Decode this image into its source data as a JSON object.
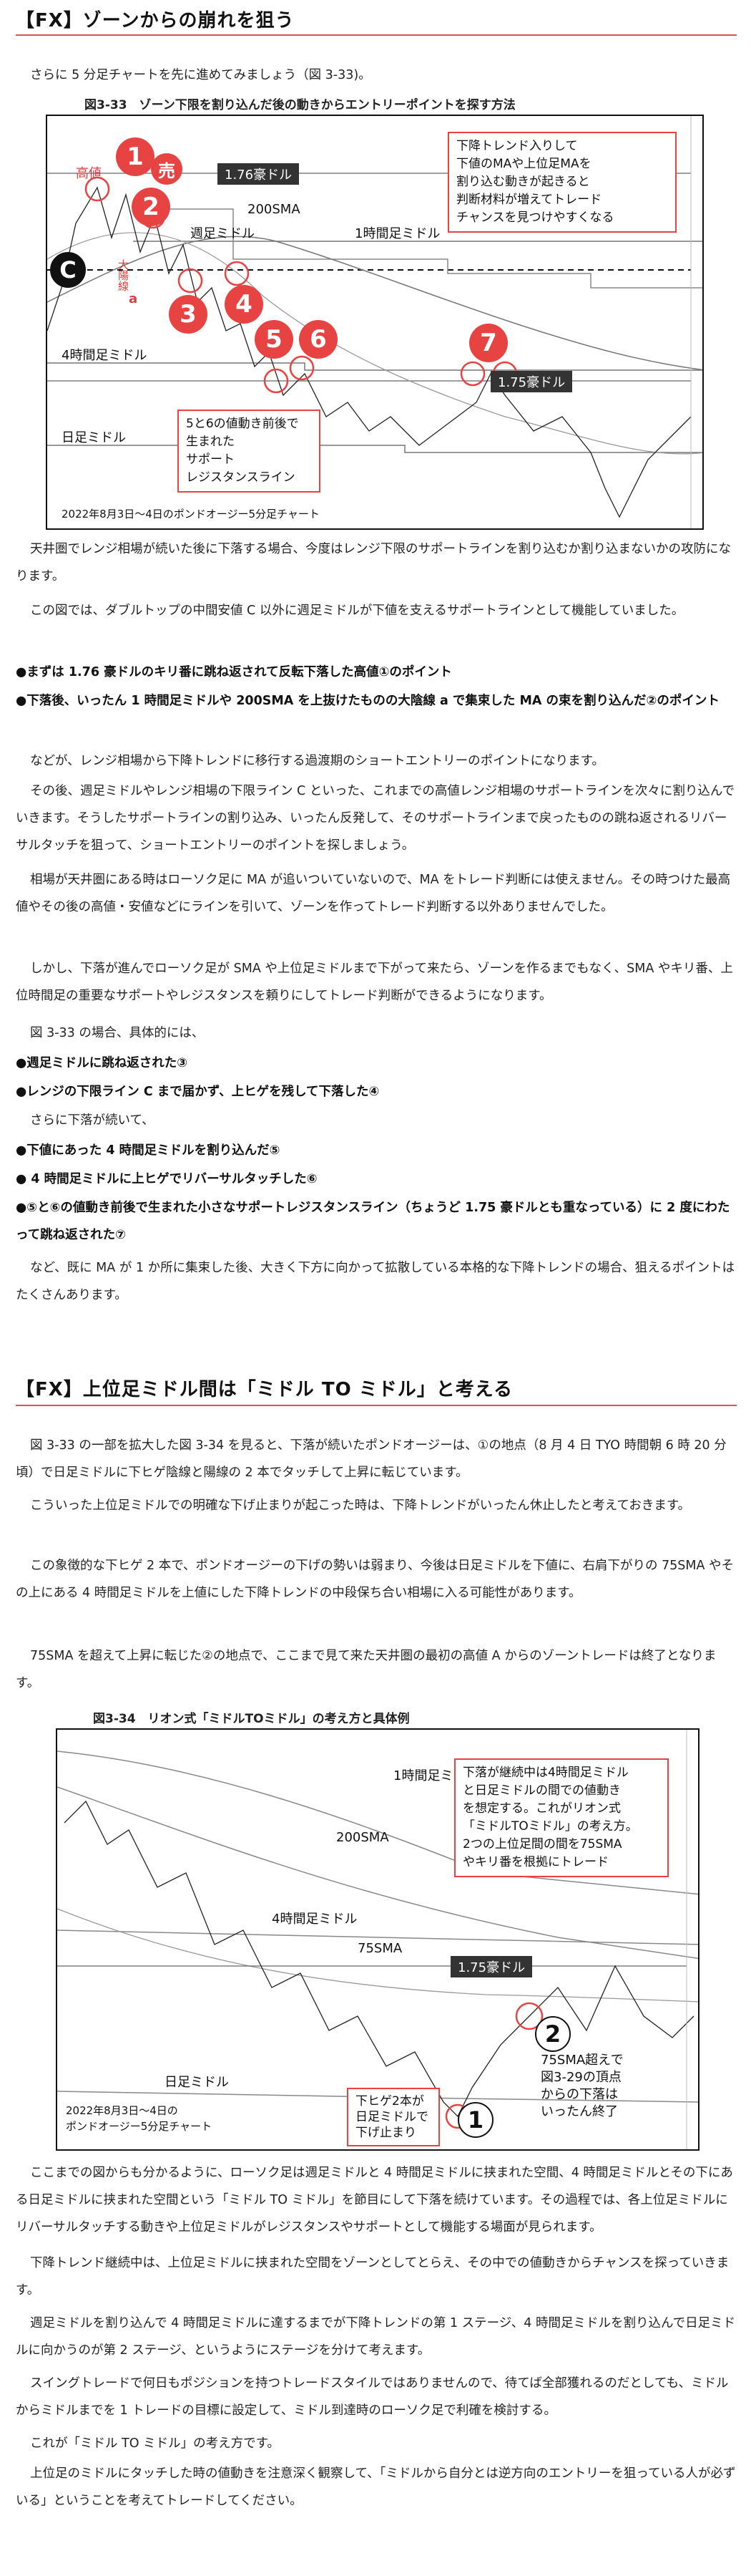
{
  "section1": {
    "heading": "【FX】ゾーンからの崩れを狙う",
    "intro": "さらに 5 分足チャートを先に進めてみましょう（図 3-33)。",
    "figure_title": "図3-33　ゾーン下限を割り込んだ後の動きからエントリーポイントを探す方法",
    "chart": {
      "price_tag_top": "1.76豪ドル",
      "price_tag_mid": "1.75豪ドル",
      "label_sma200": "200SMA",
      "label_weekly": "週足ミドル",
      "label_hourly": "1時間足ミドル",
      "label_4h": "4時間足ミドル",
      "label_daily": "日足ミドル",
      "label_high": "高値",
      "label_sell": "売",
      "label_c": "C",
      "label_big_yosen": "大陽線",
      "label_a": "a",
      "numbers": [
        "1",
        "2",
        "3",
        "4",
        "5",
        "6",
        "7"
      ],
      "note_box": "下降トレンド入りして\n下値のMAや上位足MAを\n割り込む動きが起きると\n判断材料が増えてトレード\nチャンスを見つけやすくなる",
      "note_box2": "5と6の値動き前後で\n生まれた\nサポート\nレジスタンスライン",
      "caption": "2022年8月3日～4日のポンドオージー5分足チャート"
    },
    "paragraphs": [
      "天井圏でレンジ相場が続いた後に下落する場合、今度はレンジ下限のサポートラインを割り込むか割り込まないかの攻防になります。",
      "この図では、ダブルトップの中間安値 C 以外に週足ミドルが下値を支えるサポートラインとして機能していました。",
      "●まずは 1.76 豪ドルのキリ番に跳ね返されて反転下落した高値①のポイント",
      "●下落後、いったん 1 時間足ミドルや 200SMA を上抜けたものの大陰線 a で集束した MA の束を割り込んだ②のポイント",
      "などが、レンジ相場から下降トレンドに移行する過渡期のショートエントリーのポイントになります。",
      "その後、週足ミドルやレンジ相場の下限ライン C といった、これまでの高値レンジ相場のサポートラインを次々に割り込んでいきます。そうしたサポートラインの割り込み、いったん反発して、そのサポートラインまで戻ったものの跳ね返されるリバーサルタッチを狙って、ショートエントリーのポイントを探しましょう。",
      "相場が天井圏にある時はローソク足に MA が追いついていないので、MA をトレード判断には使えません。その時つけた最高値やその後の高値・安値などにラインを引いて、ゾーンを作ってトレード判断する以外ありませんでした。",
      "しかし、下落が進んでローソク足が SMA や上位足ミドルまで下がって来たら、ゾーンを作るまでもなく、SMA やキリ番、上位時間足の重要なサポートやレジスタンスを頼りにしてトレード判断ができるようになります。",
      "図 3-33 の場合、具体的には、",
      "●週足ミドルに跳ね返された③",
      "●レンジの下限ライン C まで届かず、上ヒゲを残して下落した④",
      "さらに下落が続いて、",
      "●下値にあった 4 時間足ミドルを割り込んだ⑤",
      "● 4 時間足ミドルに上ヒゲでリバーサルタッチした⑥",
      "●⑤と⑥の値動き前後で生まれた小さなサポートレジスタンスライン（ちょうど 1.75 豪ドルとも重なっている）に 2 度にわたって跳ね返された⑦",
      "など、既に MA が 1 か所に集束した後、大きく下方に向かって拡散している本格的な下降トレンドの場合、狙えるポイントはたくさんあります。"
    ]
  },
  "section2": {
    "heading": "【FX】上位足ミドル間は「ミドル TO ミドル」と考える",
    "paragraphs": [
      "図 3-33 の一部を拡大した図 3-34 を見ると、下落が続いたポンドオージーは、①の地点（8 月 4 日 TYO 時間朝 6 時 20 分頃）で日足ミドルに下ヒゲ陰線と陽線の 2 本でタッチして上昇に転じています。",
      "こういった上位足ミドルでの明確な下げ止まりが起こった時は、下降トレンドがいったん休止したと考えておきます。",
      "この象徴的な下ヒゲ 2 本で、ポンドオージーの下げの勢いは弱まり、今後は日足ミドルを下値に、右肩下がりの 75SMA やその上にある 4 時間足ミドルを上値にした下降トレンドの中段保ち合い相場に入る可能性があります。",
      "75SMA を超えて上昇に転じた②の地点で、ここまで見て来た天井圏の最初の高値 A からのゾーントレードは終了となります。"
    ],
    "figure_title": "図3-34　リオン式「ミドルTOミドル」の考え方と具体例",
    "chart": {
      "label_hourly": "1時間足ミドル",
      "label_sma200": "200SMA",
      "label_4h": "4時間足ミドル",
      "label_sma75": "75SMA",
      "price_tag": "1.75豪ドル",
      "label_daily": "日足ミドル",
      "caption_line1": "2022年8月3日～4日の",
      "caption_line2": "ポンドオージー5分足チャート",
      "note_box": "下落が継続中は4時間足ミドル\nと日足ミドルの間での値動き\nを想定する。これがリオン式\n「ミドルTOミドル」の考え方。\n2つの上位足間の間を75SMA\nやキリ番を根拠にトレード",
      "note_small1": "下ヒゲ2本が\n日足ミドルで\n下げ止まり",
      "note_small2": "75SMA超えで\n図3-29の頂点\nからの下落は\nいったん終了",
      "numbers": [
        "1",
        "2"
      ]
    },
    "paragraphs_after": [
      "ここまでの図からも分かるように、ローソク足は週足ミドルと 4 時間足ミドルに挟まれた空間、4 時間足ミドルとその下にある日足ミドルに挟まれた空間という「ミドル TO ミドル」を節目にして下落を続けています。その過程では、各上位足ミドルにリバーサルタッチする動きや上位足ミドルがレジスタンスやサポートとして機能する場面が見られます。",
      "下降トレンド継続中は、上位足ミドルに挟まれた空間をゾーンとしてとらえ、その中での値動きからチャンスを探っていきます。",
      "週足ミドルを割り込んで 4 時間足ミドルに達するまでが下降トレンドの第 1 ステージ、4 時間足ミドルを割り込んで日足ミドルに向かうのが第 2 ステージ、というようにステージを分けて考えます。",
      "スイングトレードで何日もポジションを持つトレードスタイルではありませんので、待てば全部獲れるのだとしても、ミドルからミドルまでを 1 トレードの目標に設定して、ミドル到達時のローソク足で利確を検討する。",
      "これが「ミドル TO ミドル」の考え方です。",
      "上位足のミドルにタッチした時の値動きを注意深く観察して、「ミドルから自分とは逆方向のエントリーを狙っている人が必ずいる」ということを考えてトレードしてください。"
    ]
  },
  "colors": {
    "accent": "#e84343",
    "rule": "#d9534f"
  }
}
